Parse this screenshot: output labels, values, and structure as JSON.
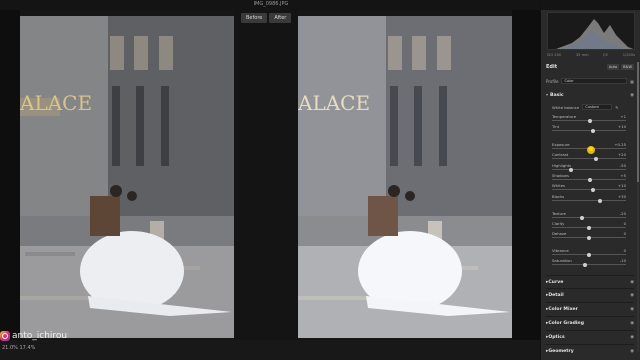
{
  "window": {
    "filename": "IMG_0986.JPG"
  },
  "compare": {
    "before": "Before",
    "after": "After"
  },
  "credit": {
    "handle": "anto_ichirou"
  },
  "status": {
    "zoom": "21.0%   17.4%"
  },
  "panel": {
    "meta": [
      "ISO 200",
      "35 mm",
      "f/2",
      "1/200s"
    ],
    "edit_label": "Edit",
    "edit_buttons": [
      "Auto",
      "B&W"
    ],
    "profile_label": "Profile",
    "profile_value": "Color",
    "basic_label": "Basic",
    "wb_label": "White balance",
    "wb_value": "Custom",
    "sliders": [
      {
        "name": "Temperature",
        "value": "+1",
        "pos": 0.51
      },
      {
        "name": "Tint",
        "value": "+10",
        "pos": 0.55
      },
      {
        "name": "Exposure",
        "value": "+0.25",
        "pos": 0.53
      },
      {
        "name": "Contrast",
        "value": "+20",
        "pos": 0.6
      },
      {
        "name": "Highlights",
        "value": "-50",
        "pos": 0.25
      },
      {
        "name": "Shadows",
        "value": "+5",
        "pos": 0.52
      },
      {
        "name": "Whites",
        "value": "+10",
        "pos": 0.55
      },
      {
        "name": "Blacks",
        "value": "+30",
        "pos": 0.65
      },
      {
        "name": "Texture",
        "value": "-20",
        "pos": 0.4
      },
      {
        "name": "Clarity",
        "value": "0",
        "pos": 0.5
      },
      {
        "name": "Dehaze",
        "value": "0",
        "pos": 0.5
      },
      {
        "name": "Vibrance",
        "value": "0",
        "pos": 0.5
      },
      {
        "name": "Saturation",
        "value": "-10",
        "pos": 0.45
      }
    ],
    "sections": [
      "Curve",
      "Detail",
      "Color Mixer",
      "Color Grading",
      "Optics",
      "Geometry"
    ]
  },
  "colors": {
    "accent": "#ffd600",
    "panel": "#2a2a2a"
  }
}
